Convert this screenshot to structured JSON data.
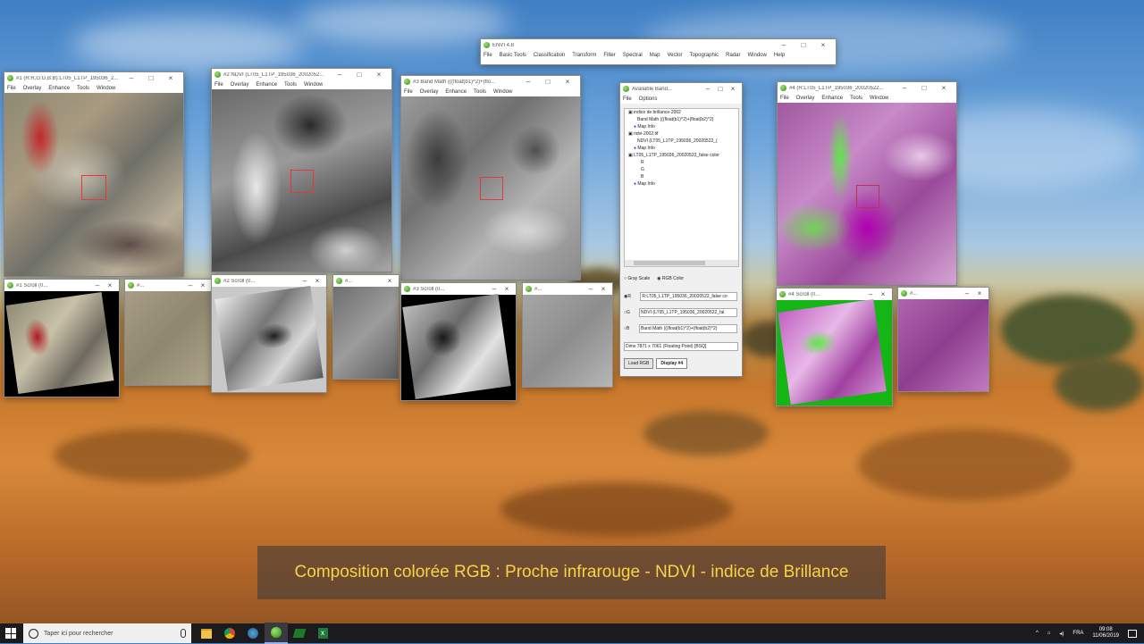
{
  "envi_main": {
    "title": "ENVI 4.8",
    "menu": [
      "File",
      "Basic Tools",
      "Classification",
      "Transform",
      "Filter",
      "Spectral",
      "Map",
      "Vector",
      "Topographic",
      "Radar",
      "Window",
      "Help"
    ]
  },
  "image_windows": [
    {
      "title": "#1 (R:R,G:G,B:B):LT05_L1TP_195036_2...",
      "menu": [
        "File",
        "Overlay",
        "Enhance",
        "Tools",
        "Window"
      ]
    },
    {
      "title": "#2 NDVI (LT05_L1TP_195036_2002052...",
      "menu": [
        "File",
        "Overlay",
        "Enhance",
        "Tools",
        "Window"
      ]
    },
    {
      "title": "#3 Band Math (((float(b1)^2)+(flo...",
      "menu": [
        "File",
        "Overlay",
        "Enhance",
        "Tools",
        "Window"
      ]
    },
    {
      "title": "#4 (R:LT05_L1TP_195036_20020522...",
      "menu": [
        "File",
        "Overlay",
        "Enhance",
        "Tools",
        "Window"
      ]
    }
  ],
  "scroll_windows": [
    {
      "title": "#1 Scroll (0..."
    },
    {
      "title": "#..."
    },
    {
      "title": "#2 Scroll (0..."
    },
    {
      "title": "#..."
    },
    {
      "title": "#3 Scroll (0..."
    },
    {
      "title": "#..."
    },
    {
      "title": "#4 Scroll (0..."
    },
    {
      "title": "#..."
    }
  ],
  "bands": {
    "title": "Available Band...",
    "menu": [
      "File",
      "Options"
    ],
    "tree": [
      "indice de brillance-2002",
      "Band Math (((float(b1)^2)+(float(b2)^2)",
      "Map Info",
      "ndvi-2002.tif",
      "NDVI (LT05_L1TP_195036_20020522_(",
      "Map Info",
      "LT05_L1TP_195036_20020522_false color",
      "R",
      "G",
      "B",
      "Map Info"
    ],
    "grey_scale": "Gray Scale",
    "rgb_color": "RGB Color",
    "r_label": "R",
    "g_label": "G",
    "b_label": "B",
    "r_value": "R:LT05_L1TP_195036_20020522_false co",
    "g_value": "NDVI (LT05_L1TP_195036_20020522_fal",
    "b_value": "Band Math (((float(b1)^2)+(float(b2)^2)",
    "dims": "Dims 7871 x 7061 (Floating Point) [BSQ]",
    "load_rgb": "Load RGB",
    "display": "Display #4"
  },
  "caption": "Composition colorée RGB  : Proche infrarouge  - NDVI - indice de Brillance",
  "taskbar": {
    "search_placeholder": "Taper ici pour rechercher",
    "lang": "FRA",
    "time": "09:08",
    "date": "11/06/2019"
  },
  "icons": [
    "windows-start-icon",
    "search-icon",
    "mic-icon",
    "file-explorer-icon",
    "chrome-icon",
    "envi-taskbar-icon",
    "idl-taskbar-icon",
    "green-app-icon",
    "excel-icon",
    "notification-icon"
  ]
}
